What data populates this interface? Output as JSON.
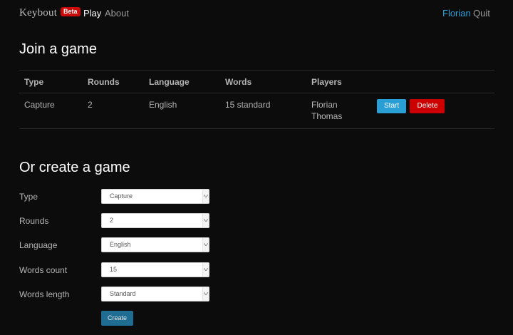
{
  "navbar": {
    "brand": "Keybout",
    "badge": "Beta",
    "links": {
      "play": "Play",
      "about": "About"
    },
    "user": "Florian",
    "quit": "Quit"
  },
  "join": {
    "title": "Join a game",
    "columns": [
      "Type",
      "Rounds",
      "Language",
      "Words",
      "Players"
    ],
    "games": [
      {
        "type": "Capture",
        "rounds": "2",
        "language": "English",
        "words": "15 standard",
        "players": [
          "Florian",
          "Thomas"
        ],
        "start_label": "Start",
        "delete_label": "Delete"
      }
    ]
  },
  "create": {
    "title": "Or create a game",
    "fields": [
      {
        "label": "Type",
        "value": "Capture"
      },
      {
        "label": "Rounds",
        "value": "2"
      },
      {
        "label": "Language",
        "value": "English"
      },
      {
        "label": "Words count",
        "value": "15"
      },
      {
        "label": "Words length",
        "value": "Standard"
      }
    ],
    "submit_label": "Create"
  },
  "colors": {
    "background": "#0c0c0c",
    "accent": "#2a9fd6",
    "danger": "#cc0000",
    "badge": "#cc0a0a"
  }
}
